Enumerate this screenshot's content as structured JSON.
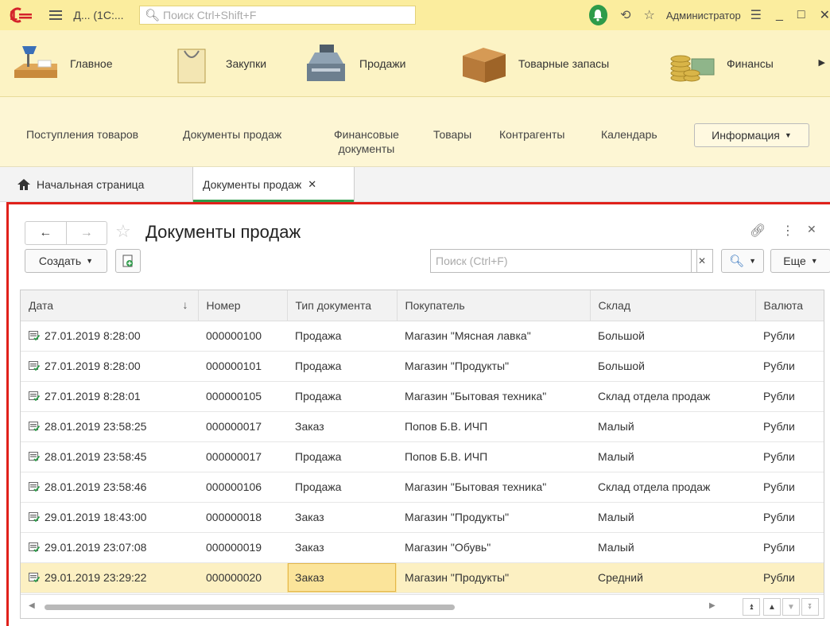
{
  "titlebar": {
    "app_title": "Д... (1С:...",
    "search_placeholder": "Поиск Ctrl+Shift+F",
    "user": "Администратор"
  },
  "sections": [
    {
      "label": "Главное",
      "icon": "desk-lamp-icon"
    },
    {
      "label": "Закупки",
      "icon": "shopping-bag-icon"
    },
    {
      "label": "Продажи",
      "icon": "cash-register-icon"
    },
    {
      "label": "Товарные запасы",
      "icon": "box-icon"
    },
    {
      "label": "Финансы",
      "icon": "coins-icon"
    }
  ],
  "subnav": {
    "links": [
      "Поступления товаров",
      "Документы продаж",
      "Финансовые документы",
      "Товары",
      "Контрагенты",
      "Календарь"
    ],
    "info_button": "Информация"
  },
  "tabs": {
    "home": "Начальная страница",
    "active": "Документы продаж"
  },
  "form": {
    "title": "Документы продаж",
    "create_button": "Создать",
    "search_placeholder": "Поиск (Ctrl+F)",
    "more_button": "Еще"
  },
  "table": {
    "columns": [
      "Дата",
      "Номер",
      "Тип документа",
      "Покупатель",
      "Склад",
      "Валюта"
    ],
    "rows": [
      [
        "27.01.2019 8:28:00",
        "000000100",
        "Продажа",
        "Магазин \"Мясная лавка\"",
        "Большой",
        "Рубли"
      ],
      [
        "27.01.2019 8:28:00",
        "000000101",
        "Продажа",
        "Магазин \"Продукты\"",
        "Большой",
        "Рубли"
      ],
      [
        "27.01.2019 8:28:01",
        "000000105",
        "Продажа",
        "Магазин \"Бытовая техника\"",
        "Склад отдела продаж",
        "Рубли"
      ],
      [
        "28.01.2019 23:58:25",
        "000000017",
        "Заказ",
        "Попов Б.В. ИЧП",
        "Малый",
        "Рубли"
      ],
      [
        "28.01.2019 23:58:45",
        "000000017",
        "Продажа",
        "Попов Б.В. ИЧП",
        "Малый",
        "Рубли"
      ],
      [
        "28.01.2019 23:58:46",
        "000000106",
        "Продажа",
        "Магазин \"Бытовая техника\"",
        "Склад отдела продаж",
        "Рубли"
      ],
      [
        "29.01.2019 18:43:00",
        "000000018",
        "Заказ",
        "Магазин \"Продукты\"",
        "Малый",
        "Рубли"
      ],
      [
        "29.01.2019 23:07:08",
        "000000019",
        "Заказ",
        "Магазин \"Обувь\"",
        "Малый",
        "Рубли"
      ],
      [
        "29.01.2019 23:29:22",
        "000000020",
        "Заказ",
        "Магазин \"Продукты\"",
        "Средний",
        "Рубли"
      ]
    ],
    "selected_row": 8
  },
  "colors": {
    "titlebar": "#FBED9E",
    "sections": "#FCF3C4",
    "accent_green": "#2e9b4a",
    "highlight_red": "#e0211b",
    "selected_row": "#FCF0C2"
  }
}
